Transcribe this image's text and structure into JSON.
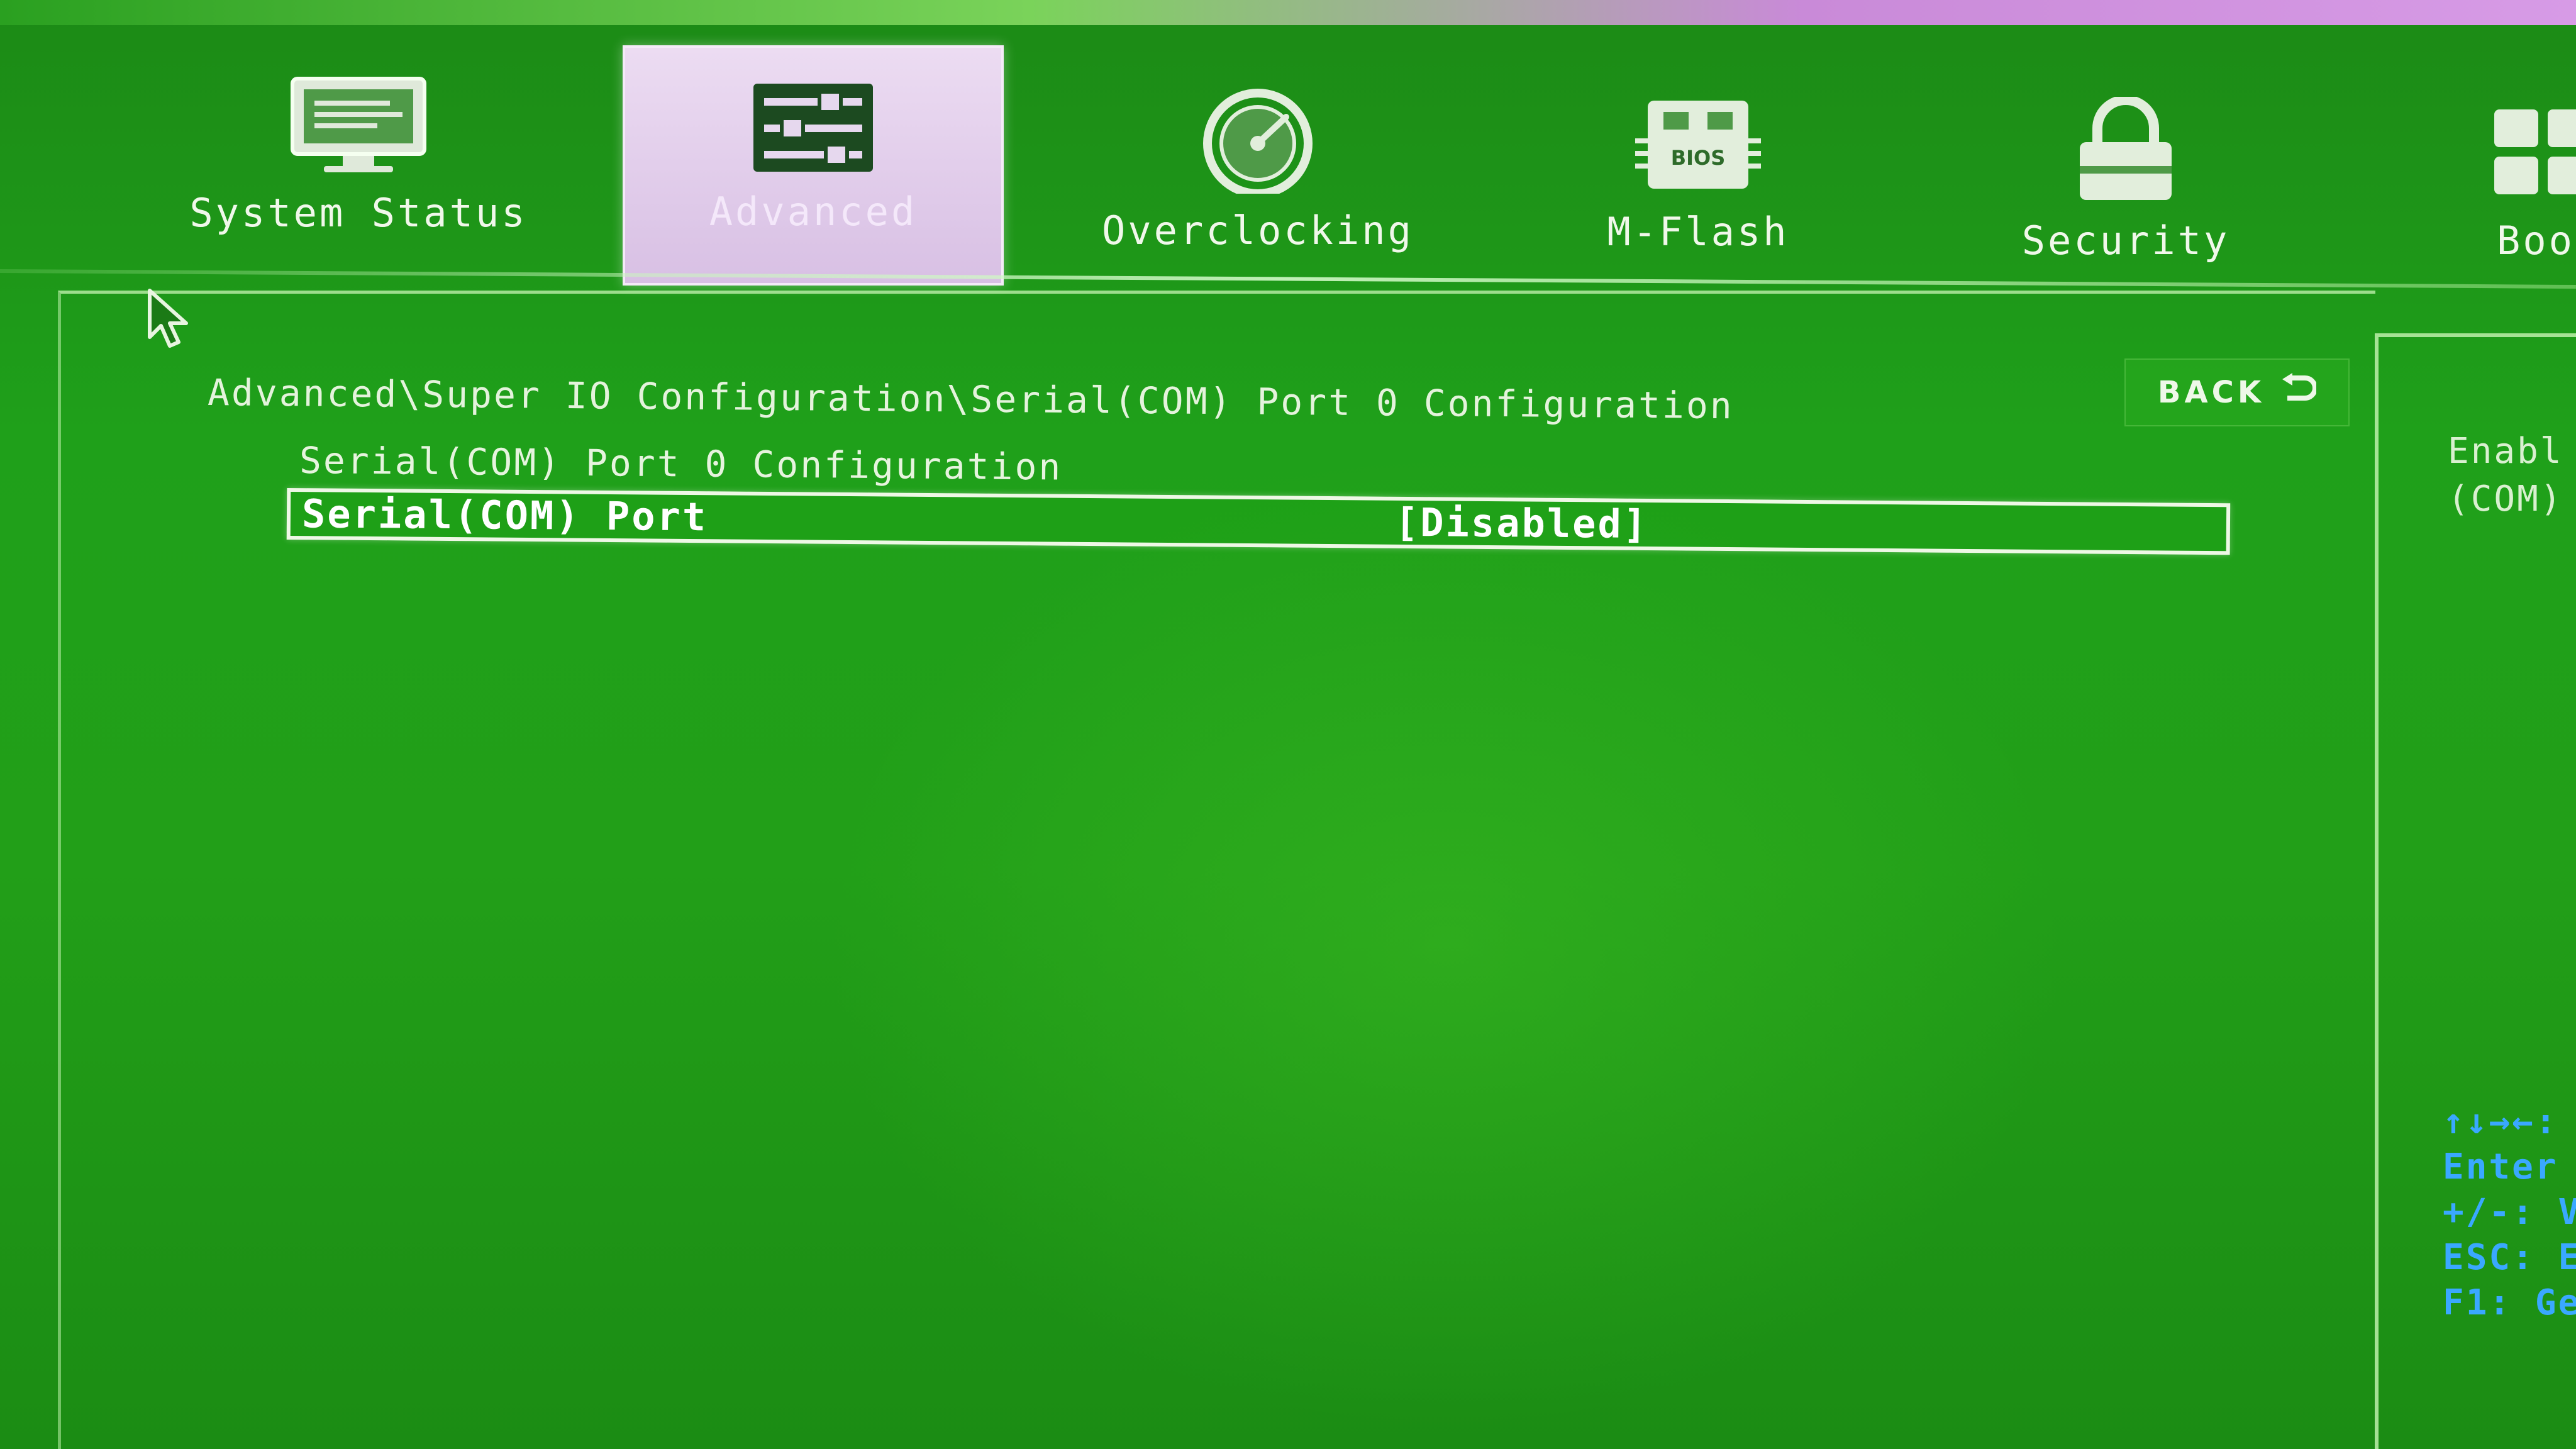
{
  "tabs": [
    {
      "label": "System Status",
      "icon": "monitor-icon",
      "active": false
    },
    {
      "label": "Advanced",
      "icon": "settings-sliders-icon",
      "active": true
    },
    {
      "label": "Overclocking",
      "icon": "speedometer-icon",
      "active": false
    },
    {
      "label": "M-Flash",
      "icon": "bios-chip-icon",
      "active": false
    },
    {
      "label": "Security",
      "icon": "padlock-icon",
      "active": false
    },
    {
      "label": "Boo",
      "icon": "boot-grid-icon",
      "active": false
    }
  ],
  "bios_chip_text": "BIOS",
  "breadcrumb": "Advanced\\Super IO Configuration\\Serial(COM) Port 0 Configuration",
  "back_button": {
    "label": "BACK",
    "icon": "return-arrow-icon"
  },
  "section_title": "Serial(COM) Port 0 Configuration",
  "setting": {
    "name": "Serial(COM) Port",
    "value": "[Disabled]"
  },
  "help": {
    "line1": "Enabl",
    "line2": "(COM)"
  },
  "key_help": [
    "↑↓→←:",
    "Enter",
    "+/-: V",
    "ESC: E",
    "F1: Ge"
  ],
  "colors": {
    "background_green": "#1fa01a",
    "active_tab": "#d8c0e4",
    "key_help_blue": "#3aa8ff",
    "text": "#e8f5e0"
  }
}
